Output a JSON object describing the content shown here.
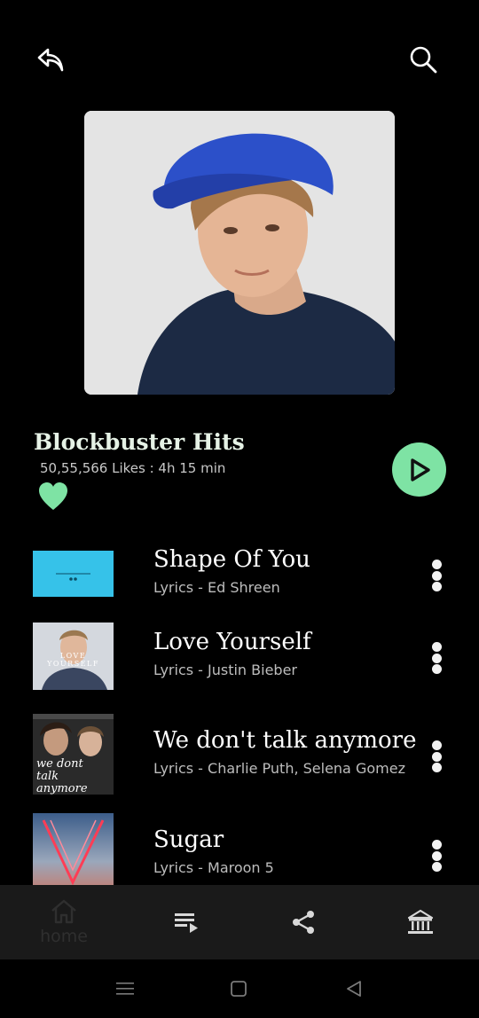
{
  "header": {
    "back_icon": "back-arrow-icon",
    "search_icon": "search-icon"
  },
  "playlist": {
    "title": "Blockbuster Hits",
    "meta": "50,55,566 Likes : 4h 15 min",
    "liked": true,
    "accent_color": "#7ee3a4"
  },
  "songs": [
    {
      "title": "Shape Of You",
      "subtitle": "Lyrics - Ed Shreen"
    },
    {
      "title": "Love Yourself",
      "subtitle": "Lyrics - Justin Bieber",
      "art_text": "LOVE YOURSELF"
    },
    {
      "title": "We don't talk anymore",
      "subtitle": "Lyrics - Charlie Puth, Selena Gomez",
      "art_text": "we dont talk anymore"
    },
    {
      "title": "Sugar",
      "subtitle": "Lyrics - Maroon 5"
    }
  ],
  "bottom_nav": {
    "home_label": "home",
    "items": [
      "home-icon",
      "queue-icon",
      "share-icon",
      "library-icon"
    ]
  },
  "system_nav": [
    "menu-icon",
    "square-icon",
    "back-triangle-icon"
  ]
}
